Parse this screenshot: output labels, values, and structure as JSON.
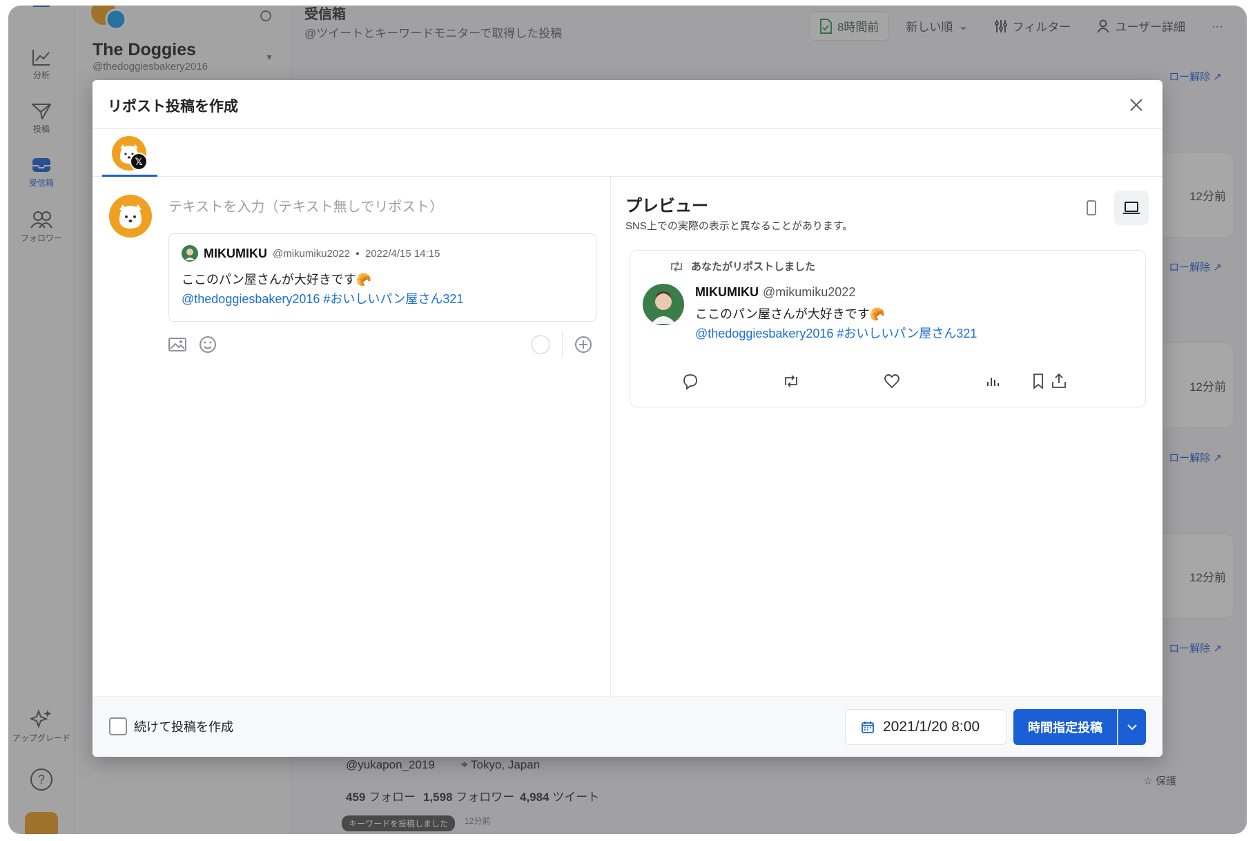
{
  "sidebar": {
    "items": [
      {
        "label": "分析",
        "icon": "chart-line-icon"
      },
      {
        "label": "投稿",
        "icon": "send-icon"
      },
      {
        "label": "受信箱",
        "icon": "inbox-icon"
      },
      {
        "label": "フォロワー",
        "icon": "users-icon"
      }
    ],
    "upgrade_label": "アップグレード",
    "help_icon": "help-icon"
  },
  "account": {
    "name": "The Doggies",
    "handle": "@thedoggiesbakery2016"
  },
  "inbox": {
    "title": "受信箱",
    "subtitle": "@ツイートとキーワードモニターで取得した投稿",
    "toolbar": {
      "time_label": "8時間前",
      "sort_label": "新しい順",
      "filter_label": "フィルター",
      "user_detail_label": "ユーザー詳細",
      "more_label": "···"
    },
    "feed_times": [
      "12分前",
      "12分前",
      "12分前"
    ],
    "unfollow_label": "ロー解除",
    "bottom_user": {
      "handle": "@yukapon_2019",
      "location": "Tokyo, Japan",
      "follow_count": "459",
      "follow_label": "フォロー",
      "follower_count": "1,598",
      "follower_label": "フォロワー",
      "tweet_count": "4,984",
      "tweet_label": "ツイート",
      "badge": "キーワードを投稿しました",
      "badge_time": "12分前",
      "protect_label": "保護"
    }
  },
  "modal": {
    "title": "リポスト投稿を作成",
    "editor": {
      "placeholder": "テキストを入力（テキスト無しでリポスト）",
      "quote": {
        "name": "MIKUMIKU",
        "handle": "@mikumiku2022",
        "date": "2022/4/15 14:15",
        "text": "ここのパン屋さんが大好きです🥐",
        "link_text": "@thedoggiesbakery2016 #おいしいパン屋さん321"
      }
    },
    "preview": {
      "title": "プレビュー",
      "subtitle": "SNS上での実際の表示と異なることがあります。",
      "repost_label": "あなたがリポストしました",
      "name": "MIKUMIKU",
      "handle": "@mikumiku2022",
      "text": "ここのパン屋さんが大好きです🥐",
      "link_text": "@thedoggiesbakery2016 #おいしいパン屋さん321"
    },
    "footer": {
      "continue_label": "続けて投稿を作成",
      "date_value": "2021/1/20 8:00",
      "schedule_label": "時間指定投稿"
    }
  },
  "colors": {
    "accent": "#1a5fd6",
    "link": "#1a6fd6",
    "avatar_orange": "#f0a020"
  }
}
